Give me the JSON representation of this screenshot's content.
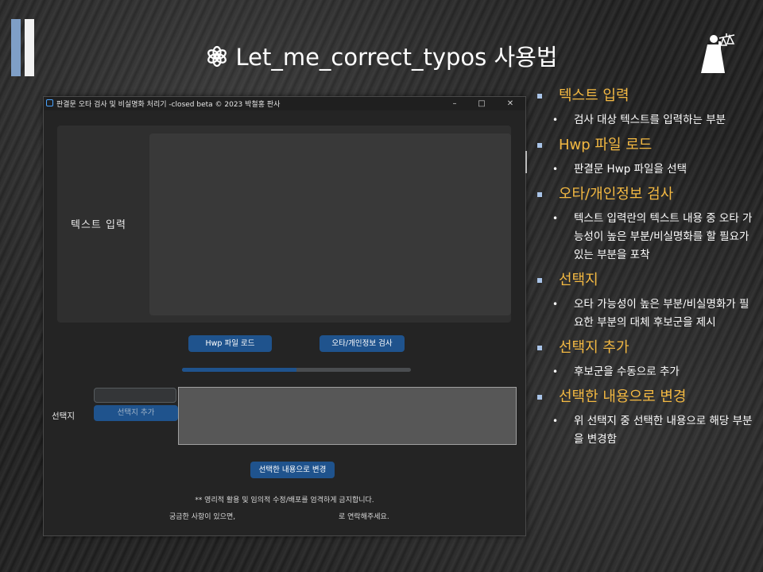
{
  "slide": {
    "title": "Let_me_correct_typos 사용법"
  },
  "app_window": {
    "title": "판결문 오타 검사 및 비실명화 처리기 -closed beta © 2023 박철홍 판사",
    "controls": {
      "minimize": "–",
      "maximize": "□",
      "close": "✕"
    },
    "input_label": "텍스트  입력",
    "hwp_button": "Hwp 파일 로드",
    "check_button": "오타/개인정보 검사",
    "progress": 0.5,
    "choice_label": "선택지",
    "choice_input_value": "",
    "add_choice_button": "선택지 추가",
    "apply_button": "선택한 내용으로 변경",
    "notice": "** 영리적 활용 및 임의적 수정/배포를 엄격하게 금지합니다.",
    "contact_prefix": "궁금한 사항이 있으면,",
    "contact_suffix": "로 연락해주세요."
  },
  "explanations": [
    {
      "heading": "텍스트 입력",
      "desc": "검사 대상 텍스트를 입력하는 부분"
    },
    {
      "heading": "Hwp 파일 로드",
      "desc": "판결문 Hwp 파일을 선택"
    },
    {
      "heading": "오타/개인정보 검사",
      "desc": "텍스트 입력란의 텍스트 내용 중 오타 가능성이 높은 부분/비실명화를 할 필요가 있는 부분을 포착"
    },
    {
      "heading": "선택지",
      "desc": "오타 가능성이 높은 부분/비실명화가 필요한 부분의 대체 후보군을 제시"
    },
    {
      "heading": "선택지 추가",
      "desc": "후보군을 수동으로 추가"
    },
    {
      "heading": "선택한 내용으로 변경",
      "desc": "위 선택지 중 선택한 내용으로 해당 부분을 변경함"
    }
  ],
  "colors": {
    "heading": "#f4b942",
    "accent_button": "#1f538d",
    "bullet_square": "#a9c4e8",
    "deck_bar_blue": "#7f9fc7"
  },
  "icons": {
    "title_icon": "openai-logo-icon",
    "corner_logo": "justice-statue-logo"
  }
}
